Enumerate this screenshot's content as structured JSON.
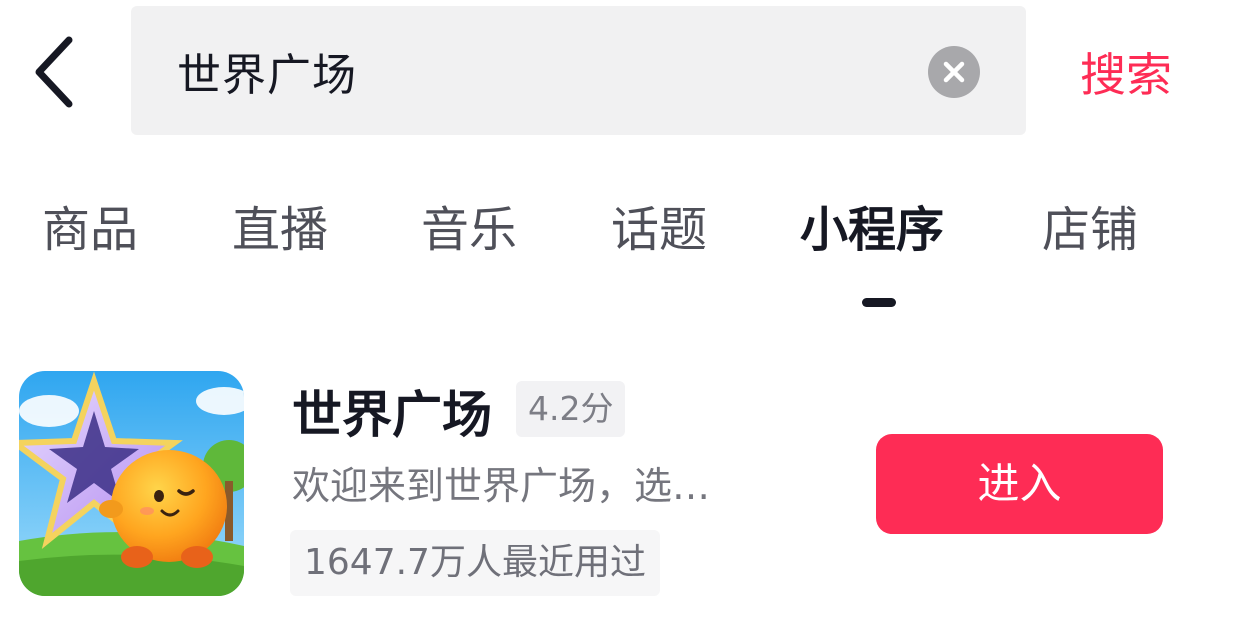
{
  "header": {
    "back_icon": "chevron-left-icon",
    "search_value": "世界广场",
    "clear_icon": "close-circle-icon",
    "search_label": "搜索"
  },
  "tabs": [
    {
      "label": "商品",
      "active": false
    },
    {
      "label": "直播",
      "active": false
    },
    {
      "label": "音乐",
      "active": false
    },
    {
      "label": "话题",
      "active": false
    },
    {
      "label": "小程序",
      "active": true
    },
    {
      "label": "店铺",
      "active": false
    }
  ],
  "result": {
    "title": "世界广场",
    "rating": "4.2分",
    "description": "欢迎来到世界广场，选…",
    "users": "1647.7万人最近用过",
    "enter_label": "进入"
  },
  "colors": {
    "accent": "#fe2c55",
    "text_primary": "#161823",
    "text_secondary": "#75767e",
    "search_bg": "#f1f1f2"
  }
}
